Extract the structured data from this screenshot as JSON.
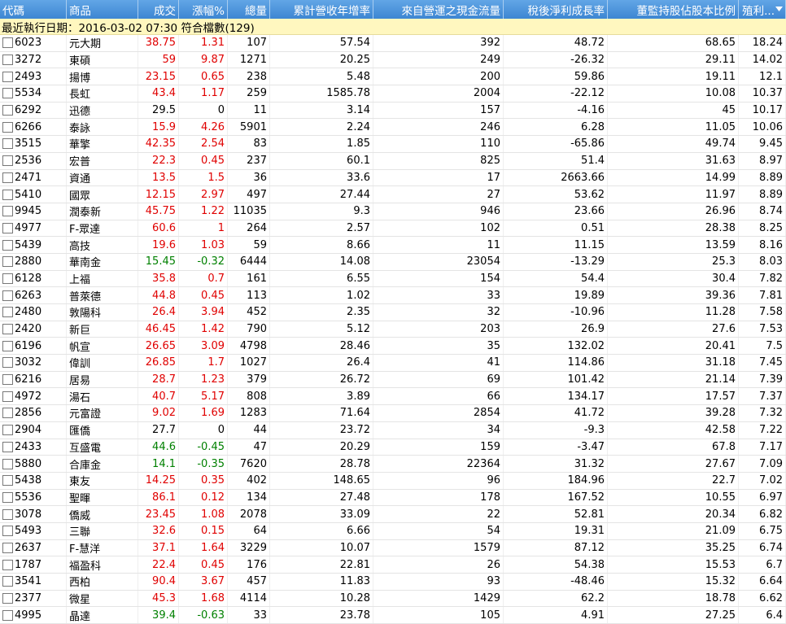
{
  "headers": [
    "代碼",
    "商品",
    "成交",
    "漲幅%",
    "總量",
    "累計營收年增率",
    "來自營運之現金流量",
    "稅後淨利成長率",
    "董監持股佔股本比例",
    "殖利..."
  ],
  "sort_icon": "triangle-down",
  "status": "最近執行日期：2016-03-02 07:30 符合檔數(129)",
  "rows": [
    {
      "code": "6023",
      "name": "元大期",
      "price": "38.75",
      "chg": "1.31",
      "dir": "up",
      "vol": "107",
      "rev": "57.54",
      "cash": "392",
      "profit": "48.72",
      "hold": "68.65",
      "yield": "18.24"
    },
    {
      "code": "3272",
      "name": "東碩",
      "price": "59",
      "chg": "9.87",
      "dir": "up",
      "vol": "1271",
      "rev": "20.25",
      "cash": "249",
      "profit": "-26.32",
      "hold": "29.11",
      "yield": "14.02"
    },
    {
      "code": "2493",
      "name": "揚博",
      "price": "23.15",
      "chg": "0.65",
      "dir": "up",
      "vol": "238",
      "rev": "5.48",
      "cash": "200",
      "profit": "59.86",
      "hold": "19.11",
      "yield": "12.1"
    },
    {
      "code": "5534",
      "name": "長虹",
      "price": "43.4",
      "chg": "1.17",
      "dir": "up",
      "vol": "259",
      "rev": "1585.78",
      "cash": "2004",
      "profit": "-22.12",
      "hold": "10.08",
      "yield": "10.37"
    },
    {
      "code": "6292",
      "name": "迅德",
      "price": "29.5",
      "chg": "0",
      "dir": "flat",
      "vol": "11",
      "rev": "3.14",
      "cash": "157",
      "profit": "-4.16",
      "hold": "45",
      "yield": "10.17"
    },
    {
      "code": "6266",
      "name": "泰詠",
      "price": "15.9",
      "chg": "4.26",
      "dir": "up",
      "vol": "5901",
      "rev": "2.24",
      "cash": "246",
      "profit": "6.28",
      "hold": "11.05",
      "yield": "10.06"
    },
    {
      "code": "3515",
      "name": "華擎",
      "price": "42.35",
      "chg": "2.54",
      "dir": "up",
      "vol": "83",
      "rev": "1.85",
      "cash": "110",
      "profit": "-65.86",
      "hold": "49.74",
      "yield": "9.45"
    },
    {
      "code": "2536",
      "name": "宏普",
      "price": "22.3",
      "chg": "0.45",
      "dir": "up",
      "vol": "237",
      "rev": "60.1",
      "cash": "825",
      "profit": "51.4",
      "hold": "31.63",
      "yield": "8.97"
    },
    {
      "code": "2471",
      "name": "資通",
      "price": "13.5",
      "chg": "1.5",
      "dir": "up",
      "vol": "36",
      "rev": "33.6",
      "cash": "17",
      "profit": "2663.66",
      "hold": "14.99",
      "yield": "8.89"
    },
    {
      "code": "5410",
      "name": "國眾",
      "price": "12.15",
      "chg": "2.97",
      "dir": "up",
      "vol": "497",
      "rev": "27.44",
      "cash": "27",
      "profit": "53.62",
      "hold": "11.97",
      "yield": "8.89"
    },
    {
      "code": "9945",
      "name": "潤泰新",
      "price": "45.75",
      "chg": "1.22",
      "dir": "up",
      "vol": "11035",
      "rev": "9.3",
      "cash": "946",
      "profit": "23.66",
      "hold": "26.96",
      "yield": "8.74"
    },
    {
      "code": "4977",
      "name": "F-眾達",
      "price": "60.6",
      "chg": "1",
      "dir": "up",
      "vol": "264",
      "rev": "2.57",
      "cash": "102",
      "profit": "0.51",
      "hold": "28.38",
      "yield": "8.25"
    },
    {
      "code": "5439",
      "name": "高技",
      "price": "19.6",
      "chg": "1.03",
      "dir": "up",
      "vol": "59",
      "rev": "8.66",
      "cash": "11",
      "profit": "11.15",
      "hold": "13.59",
      "yield": "8.16"
    },
    {
      "code": "2880",
      "name": "華南金",
      "price": "15.45",
      "chg": "-0.32",
      "dir": "down",
      "vol": "6444",
      "rev": "14.08",
      "cash": "23054",
      "profit": "-13.29",
      "hold": "25.3",
      "yield": "8.03"
    },
    {
      "code": "6128",
      "name": "上福",
      "price": "35.8",
      "chg": "0.7",
      "dir": "up",
      "vol": "161",
      "rev": "6.55",
      "cash": "154",
      "profit": "54.4",
      "hold": "30.4",
      "yield": "7.82"
    },
    {
      "code": "6263",
      "name": "普萊德",
      "price": "44.8",
      "chg": "0.45",
      "dir": "up",
      "vol": "113",
      "rev": "1.02",
      "cash": "33",
      "profit": "19.89",
      "hold": "39.36",
      "yield": "7.81"
    },
    {
      "code": "2480",
      "name": "敦陽科",
      "price": "26.4",
      "chg": "3.94",
      "dir": "up",
      "vol": "452",
      "rev": "2.35",
      "cash": "32",
      "profit": "-10.96",
      "hold": "11.28",
      "yield": "7.58"
    },
    {
      "code": "2420",
      "name": "新巨",
      "price": "46.45",
      "chg": "1.42",
      "dir": "up",
      "vol": "790",
      "rev": "5.12",
      "cash": "203",
      "profit": "26.9",
      "hold": "27.6",
      "yield": "7.53"
    },
    {
      "code": "6196",
      "name": "帆宣",
      "price": "26.65",
      "chg": "3.09",
      "dir": "up",
      "vol": "4798",
      "rev": "28.46",
      "cash": "35",
      "profit": "132.02",
      "hold": "20.41",
      "yield": "7.5"
    },
    {
      "code": "3032",
      "name": "偉訓",
      "price": "26.85",
      "chg": "1.7",
      "dir": "up",
      "vol": "1027",
      "rev": "26.4",
      "cash": "41",
      "profit": "114.86",
      "hold": "31.18",
      "yield": "7.45"
    },
    {
      "code": "6216",
      "name": "居易",
      "price": "28.7",
      "chg": "1.23",
      "dir": "up",
      "vol": "379",
      "rev": "26.72",
      "cash": "69",
      "profit": "101.42",
      "hold": "21.14",
      "yield": "7.39"
    },
    {
      "code": "4972",
      "name": "湯石",
      "price": "40.7",
      "chg": "5.17",
      "dir": "up",
      "vol": "808",
      "rev": "3.89",
      "cash": "66",
      "profit": "134.17",
      "hold": "17.57",
      "yield": "7.37"
    },
    {
      "code": "2856",
      "name": "元富證",
      "price": "9.02",
      "chg": "1.69",
      "dir": "up",
      "vol": "1283",
      "rev": "71.64",
      "cash": "2854",
      "profit": "41.72",
      "hold": "39.28",
      "yield": "7.32"
    },
    {
      "code": "2904",
      "name": "匯僑",
      "price": "27.7",
      "chg": "0",
      "dir": "flat",
      "vol": "44",
      "rev": "23.72",
      "cash": "34",
      "profit": "-9.3",
      "hold": "42.58",
      "yield": "7.22"
    },
    {
      "code": "2433",
      "name": "互盛電",
      "price": "44.6",
      "chg": "-0.45",
      "dir": "down",
      "vol": "47",
      "rev": "20.29",
      "cash": "159",
      "profit": "-3.47",
      "hold": "67.8",
      "yield": "7.17"
    },
    {
      "code": "5880",
      "name": "合庫金",
      "price": "14.1",
      "chg": "-0.35",
      "dir": "down",
      "vol": "7620",
      "rev": "28.78",
      "cash": "22364",
      "profit": "31.32",
      "hold": "27.67",
      "yield": "7.09"
    },
    {
      "code": "5438",
      "name": "東友",
      "price": "14.25",
      "chg": "0.35",
      "dir": "up",
      "vol": "402",
      "rev": "148.65",
      "cash": "96",
      "profit": "184.96",
      "hold": "22.7",
      "yield": "7.02"
    },
    {
      "code": "5536",
      "name": "聖暉",
      "price": "86.1",
      "chg": "0.12",
      "dir": "up",
      "vol": "134",
      "rev": "27.48",
      "cash": "178",
      "profit": "167.52",
      "hold": "10.55",
      "yield": "6.97"
    },
    {
      "code": "3078",
      "name": "僑威",
      "price": "23.45",
      "chg": "1.08",
      "dir": "up",
      "vol": "2078",
      "rev": "33.09",
      "cash": "22",
      "profit": "52.81",
      "hold": "20.34",
      "yield": "6.82"
    },
    {
      "code": "5493",
      "name": "三聯",
      "price": "32.6",
      "chg": "0.15",
      "dir": "up",
      "vol": "64",
      "rev": "6.66",
      "cash": "54",
      "profit": "19.31",
      "hold": "21.09",
      "yield": "6.75"
    },
    {
      "code": "2637",
      "name": "F-慧洋",
      "price": "37.1",
      "chg": "1.64",
      "dir": "up",
      "vol": "3229",
      "rev": "10.07",
      "cash": "1579",
      "profit": "87.12",
      "hold": "35.25",
      "yield": "6.74"
    },
    {
      "code": "1787",
      "name": "福盈科",
      "price": "22.4",
      "chg": "0.45",
      "dir": "up",
      "vol": "176",
      "rev": "22.81",
      "cash": "26",
      "profit": "54.38",
      "hold": "15.53",
      "yield": "6.7"
    },
    {
      "code": "3541",
      "name": "西柏",
      "price": "90.4",
      "chg": "3.67",
      "dir": "up",
      "vol": "457",
      "rev": "11.83",
      "cash": "93",
      "profit": "-48.46",
      "hold": "15.32",
      "yield": "6.64"
    },
    {
      "code": "2377",
      "name": "微星",
      "price": "45.3",
      "chg": "1.68",
      "dir": "up",
      "vol": "4114",
      "rev": "10.28",
      "cash": "1429",
      "profit": "62.2",
      "hold": "18.78",
      "yield": "6.62"
    },
    {
      "code": "4995",
      "name": "晶達",
      "price": "39.4",
      "chg": "-0.63",
      "dir": "down",
      "vol": "33",
      "rev": "23.78",
      "cash": "105",
      "profit": "4.91",
      "hold": "27.25",
      "yield": "6.4"
    }
  ]
}
